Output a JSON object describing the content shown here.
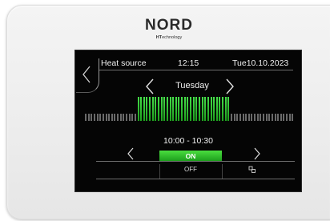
{
  "brand": {
    "name": "NORD",
    "sub_prefix": "HT",
    "sub_rest": "echnology"
  },
  "screen": {
    "header": {
      "source": "Heat source",
      "time": "12:15",
      "date": "Tue10.10.2023"
    },
    "day": {
      "label": "Tuesday"
    },
    "schedule": {
      "total_slots": 48,
      "active_slots": [
        18,
        19,
        20,
        21,
        22,
        23,
        24,
        25,
        26,
        27,
        28,
        29,
        30,
        31,
        32,
        33,
        34,
        35,
        36,
        37,
        38,
        39,
        40,
        41,
        42,
        43,
        44,
        45,
        46,
        47,
        48,
        49
      ],
      "range": "10:00 - 10:30"
    },
    "controls": {
      "on_label": "ON",
      "off_label": "OFF"
    }
  },
  "colors": {
    "active": "#2fbf2f",
    "inactive": "#6a6a6a",
    "screen_bg": "#050505"
  }
}
